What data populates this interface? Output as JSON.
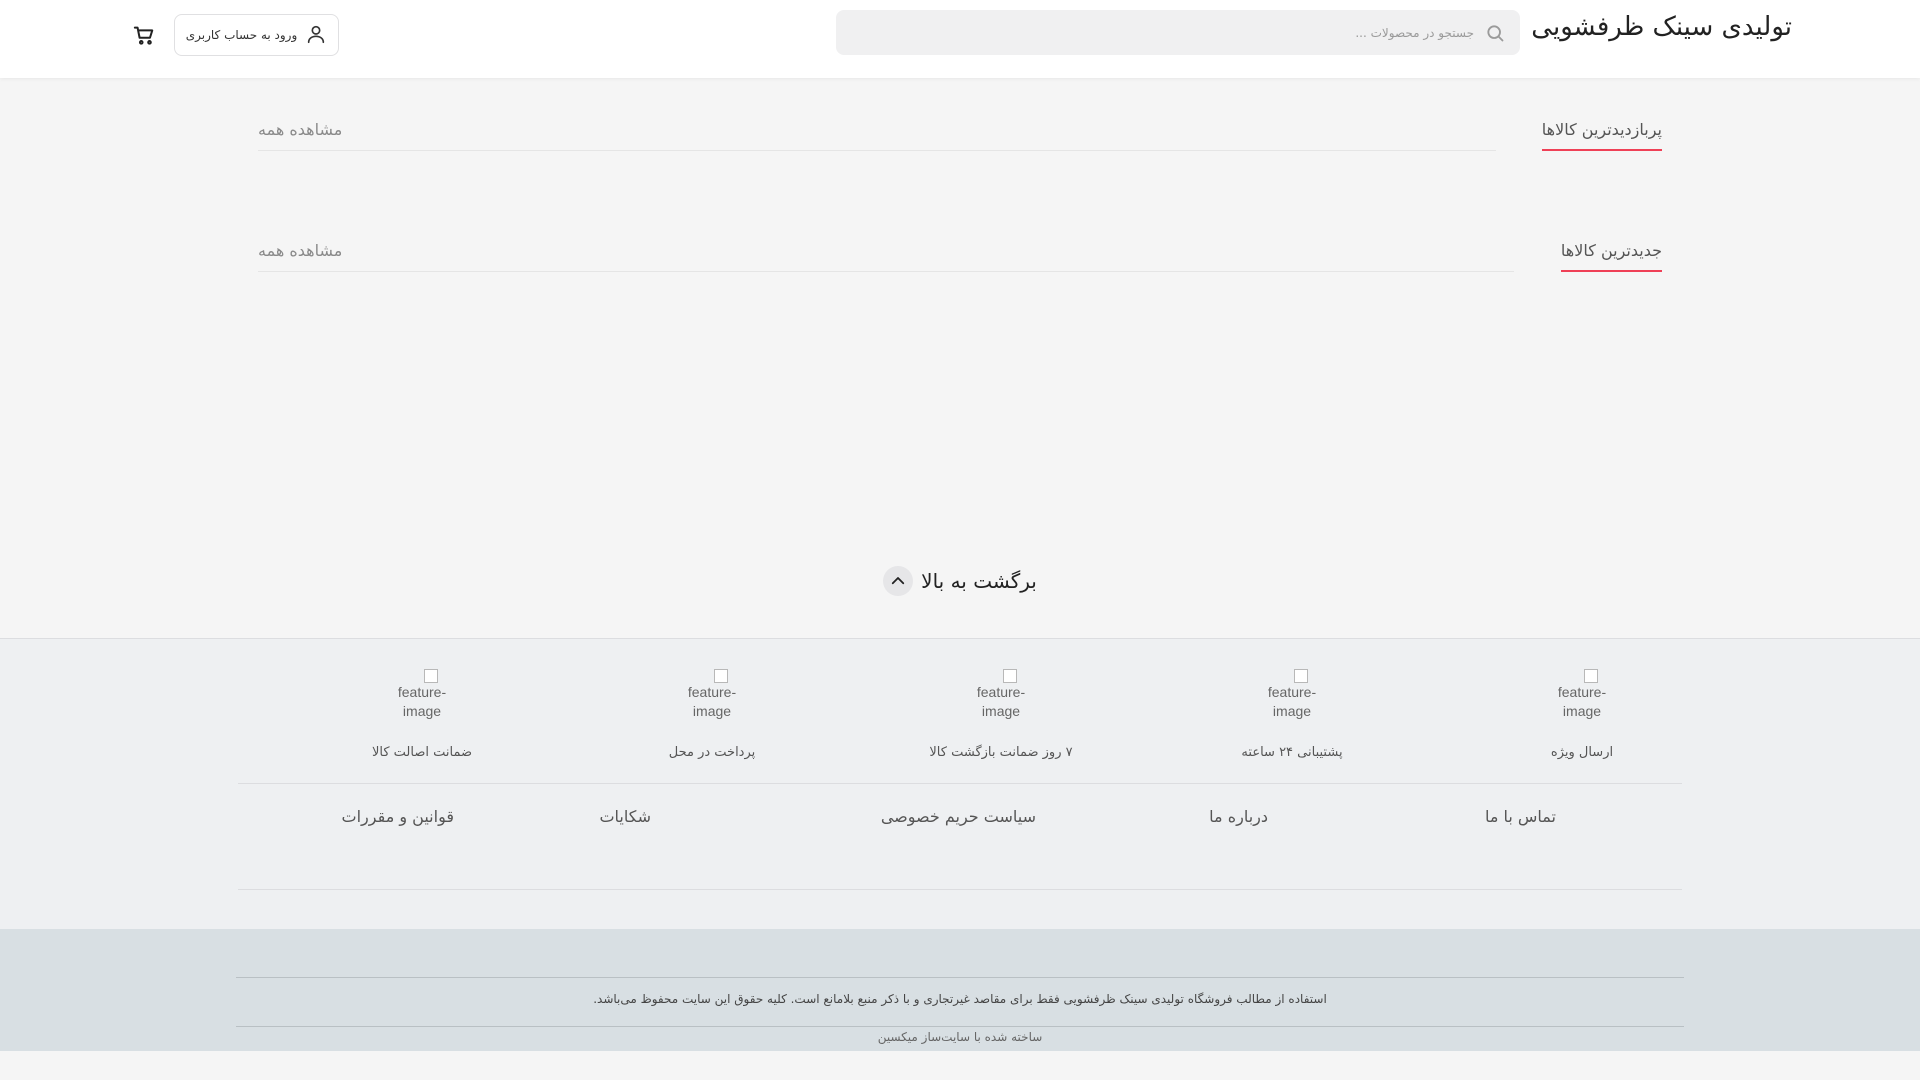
{
  "header": {
    "site_title": "تولیدی سینک ظرفشویی",
    "search_placeholder": "جستجو در محصولات ...",
    "login_label": "ورود به حساب کاربری"
  },
  "sections": [
    {
      "title": "پربازدیدترین کالاها",
      "see_all": "مشاهده همه"
    },
    {
      "title": "جدیدترین کالاها",
      "see_all": "مشاهده همه"
    }
  ],
  "back_to_top": "برگشت به بالا",
  "features": [
    {
      "image_alt": "feature-image",
      "label": "ارسال ویژه"
    },
    {
      "image_alt": "feature-image",
      "label": "پشتیبانی ۲۴ ساعته"
    },
    {
      "image_alt": "feature-image",
      "label": "۷ روز ضمانت بازگشت کالا"
    },
    {
      "image_alt": "feature-image",
      "label": "پرداخت در محل"
    },
    {
      "image_alt": "feature-image",
      "label": "ضمانت اصالت کالا"
    }
  ],
  "footer_links": [
    "تماس با ما",
    "درباره ما",
    "سیاست حریم خصوصی",
    "شکایات",
    "قوانین و مقررات"
  ],
  "copyright": "استفاده از مطالب فروشگاه تولیدی سینک ظرفشویی فقط برای مقاصد غیرتجاری و با ذکر منبع بلامانع است. کلیه حقوق این سایت محفوظ می‌باشد.",
  "made_with": "ساخته شده با سایت‌ساز میکسین",
  "icons": {
    "search": "search-icon",
    "user": "user-icon",
    "cart": "cart-icon",
    "back_to_top": "chevron-up-icon"
  },
  "colors": {
    "accent": "#ef4056",
    "footer_bg": "#eef0f2",
    "copyright_bg": "#d8dfe3"
  }
}
